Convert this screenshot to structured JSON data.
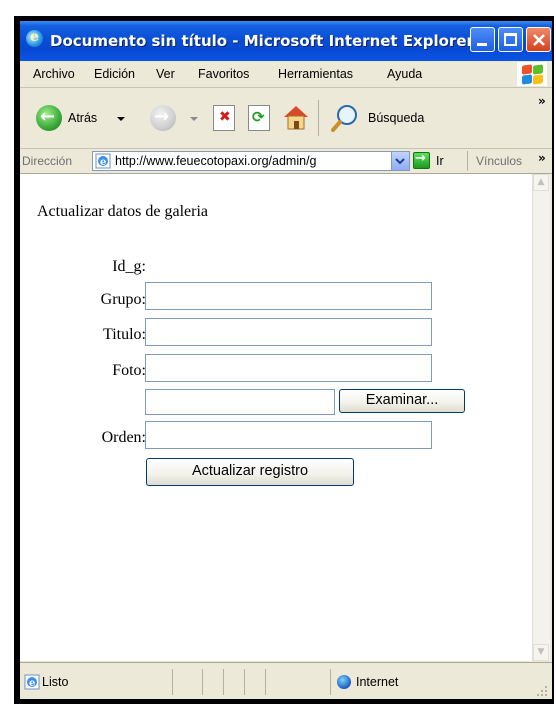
{
  "window": {
    "title": "Documento sin título - Microsoft Internet Explorer"
  },
  "menu": [
    "Archivo",
    "Edición",
    "Ver",
    "Favoritos",
    "Herramientas",
    "Ayuda"
  ],
  "toolbar": {
    "back_label": "Atrás",
    "search_label": "Búsqueda"
  },
  "address": {
    "label": "Dirección",
    "url": "http://www.feuecotopaxi.org/admin/g",
    "go_label": "Ir",
    "links_label": "Vínculos"
  },
  "page": {
    "heading": "Actualizar datos de galeria",
    "fields": [
      {
        "label": "Id_g:"
      },
      {
        "label": "Grupo:",
        "value": ""
      },
      {
        "label": "Titulo:",
        "value": ""
      },
      {
        "label": "Foto:",
        "value": ""
      },
      {
        "label": "Orden:",
        "value": ""
      }
    ],
    "browse_label": "Examinar...",
    "submit_label": "Actualizar registro"
  },
  "status": {
    "text": "Listo",
    "zone": "Internet"
  }
}
